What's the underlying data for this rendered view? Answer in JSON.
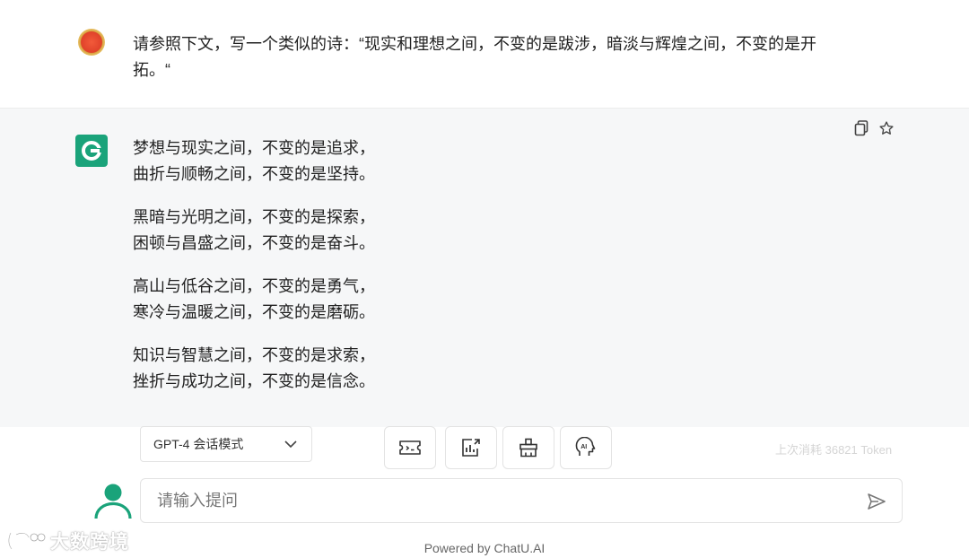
{
  "user_message": {
    "text": "请参照下文，写一个类似的诗：“现实和理想之间，不变的是跋涉，暗淡与辉煌之间，不变的是开拓。“"
  },
  "ai_message": {
    "stanzas": [
      [
        "梦想与现实之间，不变的是追求，",
        "曲折与顺畅之间，不变的是坚持。"
      ],
      [
        "黑暗与光明之间，不变的是探索，",
        "困顿与昌盛之间，不变的是奋斗。"
      ],
      [
        "高山与低谷之间，不变的是勇气，",
        "寒冷与温暖之间，不变的是磨砺。"
      ],
      [
        "知识与智慧之间，不变的是求索，",
        "挫折与成功之间，不变的是信念。"
      ]
    ],
    "tools": [
      "copy-icon",
      "star-icon"
    ]
  },
  "toolbar": {
    "model_label": "GPT-4 会话模式",
    "actions": [
      "ticket-icon",
      "chart-export-icon",
      "broom-icon",
      "ai-head-icon"
    ]
  },
  "token_info": "上次消耗 36821 Token",
  "input": {
    "placeholder": "请输入提问"
  },
  "footer": {
    "powered": "Powered by ChatU.AI",
    "watermark": "大数跨境"
  },
  "colors": {
    "ai_background": "#f6f7f8",
    "ai_avatar": "#1aa37a",
    "user_me_avatar": "#1aa37a",
    "border": "#e3e3e3"
  }
}
